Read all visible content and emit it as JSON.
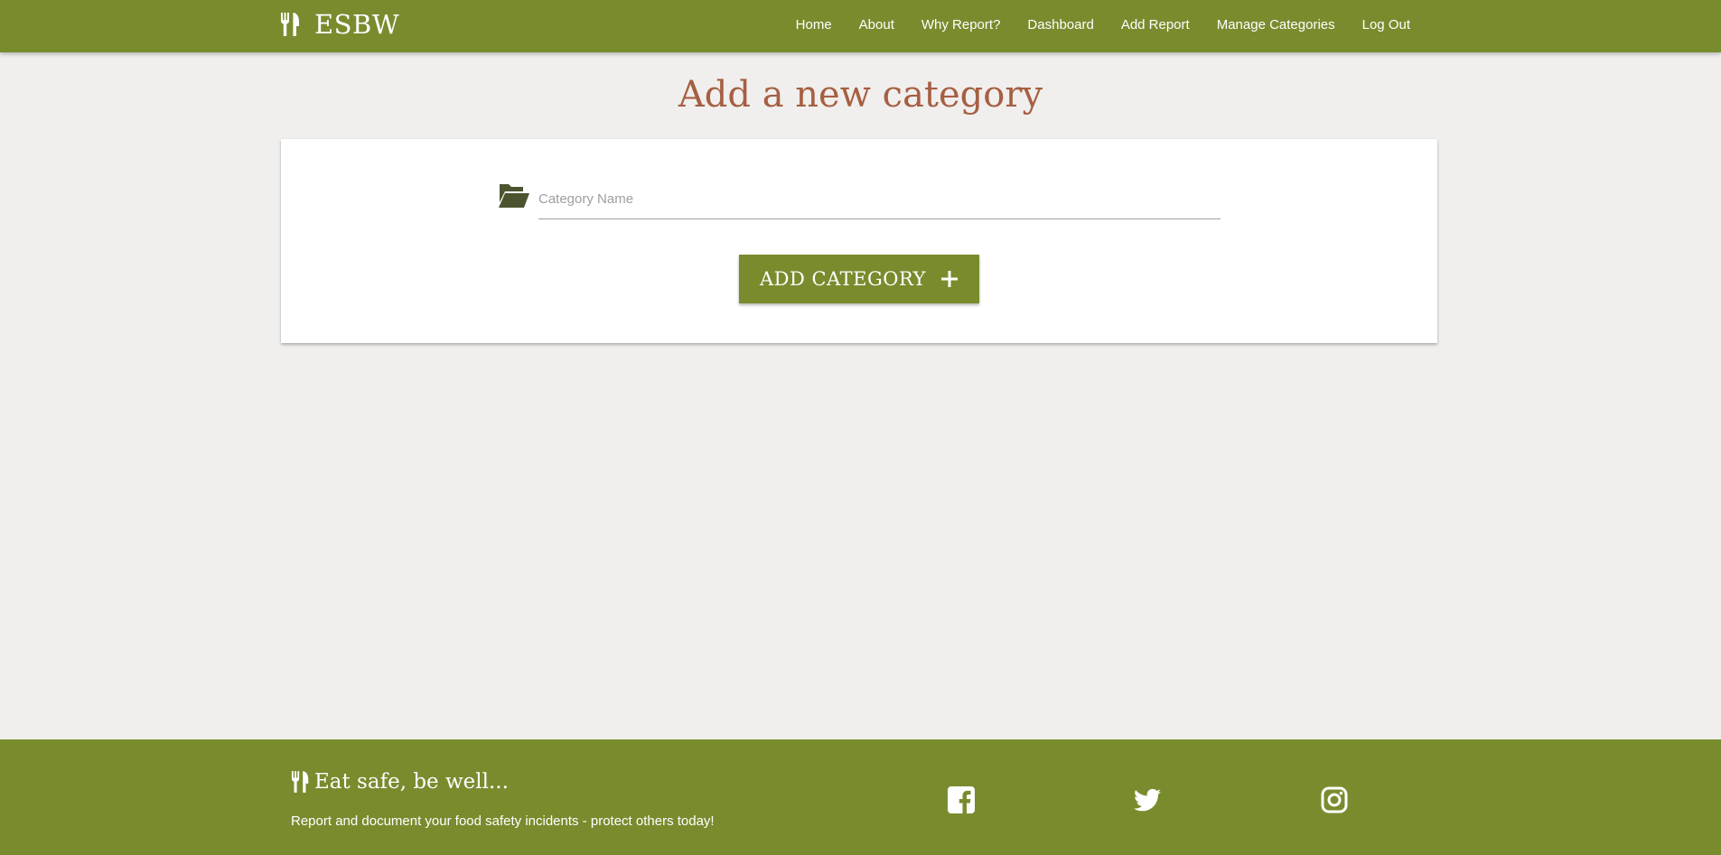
{
  "nav": {
    "brand": "ESBW",
    "brand_icon": "utensils-icon",
    "links": [
      "Home",
      "About",
      "Why Report?",
      "Dashboard",
      "Add Report",
      "Manage Categories",
      "Log Out"
    ]
  },
  "main": {
    "title": "Add a new category",
    "category_field": {
      "icon": "folder-open-icon",
      "placeholder": "Category Name",
      "value": ""
    },
    "add_button": {
      "label": "ADD CATEGORY",
      "icon": "plus-icon"
    }
  },
  "footer": {
    "tagline": "Eat safe, be well...",
    "text": "Report and document your food safety incidents - protect others today!",
    "social": [
      "facebook-icon",
      "twitter-icon",
      "instagram-icon"
    ]
  },
  "colors": {
    "primary": "#788c2e",
    "title": "#a65f42",
    "background": "#f0efed",
    "icon_dark": "#4a5530"
  }
}
